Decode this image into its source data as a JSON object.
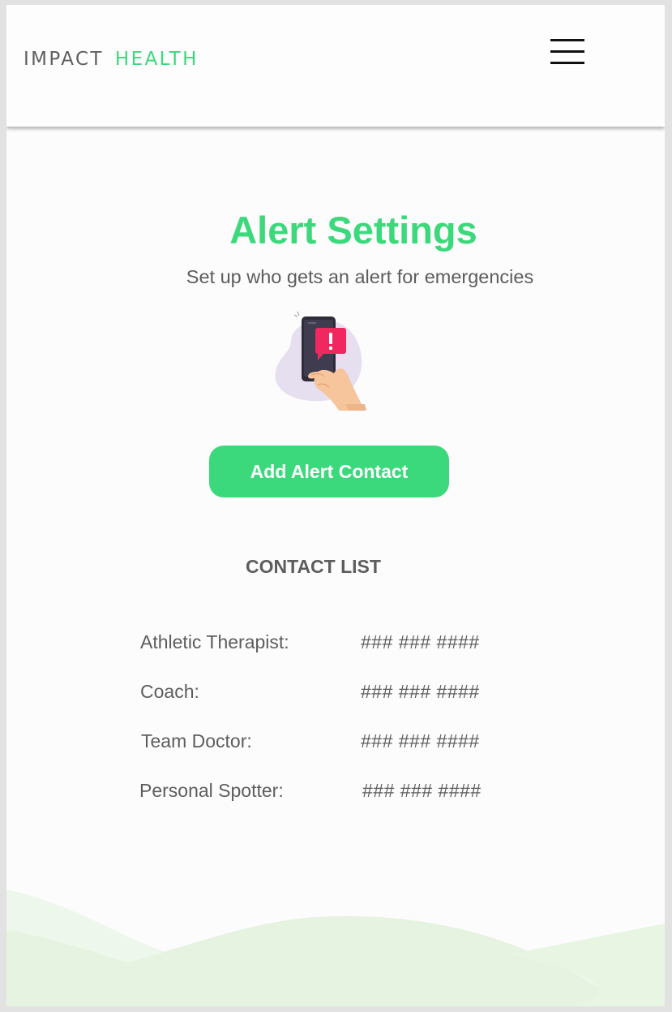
{
  "header": {
    "logo_part1": "IMPACT",
    "logo_part2": "HEALTH",
    "menu_icon": "hamburger-menu-icon"
  },
  "main": {
    "title": "Alert Settings",
    "subtitle": "Set up who gets an alert for emergencies",
    "illustration_icon": "phone-alert-illustration",
    "add_button_label": "Add Alert Contact",
    "contact_list_heading": "CONTACT LIST",
    "contacts": [
      {
        "role": "Athletic Therapist:",
        "phone": "### ### ####"
      },
      {
        "role": "Coach:",
        "phone": "### ### ####"
      },
      {
        "role": "Team Doctor:",
        "phone": "### ### ####"
      },
      {
        "role": "Personal Spotter:",
        "phone": "### ### ####"
      }
    ]
  },
  "colors": {
    "brand_green": "#3cd97c",
    "text_gray": "#5d5d5d",
    "hill_light": "#e5f3e0",
    "hill_lighter": "#eef7eb"
  }
}
